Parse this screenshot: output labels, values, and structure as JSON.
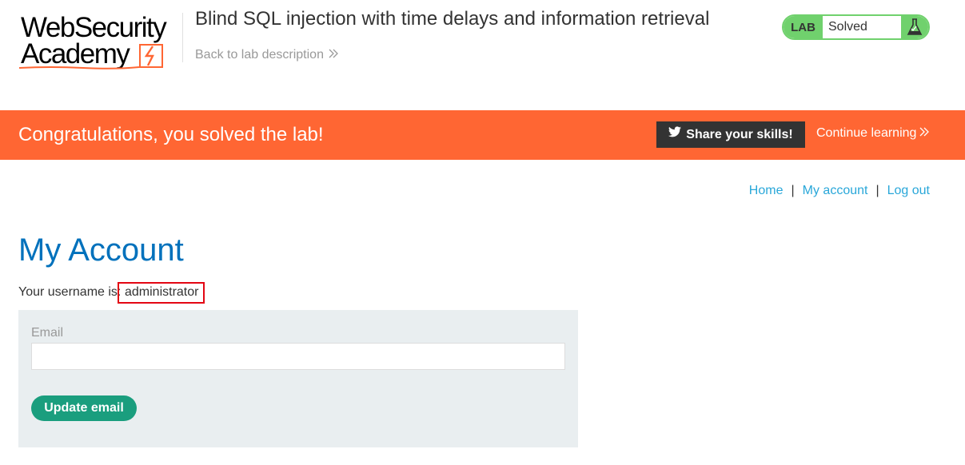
{
  "header": {
    "logo_line1": "WebSecurity",
    "logo_line2": "Academy",
    "lab_title": "Blind SQL injection with time delays and information retrieval",
    "back_link": "Back to lab description",
    "lab_badge": "LAB",
    "lab_status": "Solved"
  },
  "banner": {
    "message": "Congratulations, you solved the lab!",
    "share_button": "Share your skills!",
    "continue_link": "Continue learning"
  },
  "nav": {
    "items": [
      "Home",
      "My account",
      "Log out"
    ],
    "separator": "|"
  },
  "account": {
    "title": "My Account",
    "username_prefix": "Your username is:",
    "username": "administrator",
    "email_label": "Email",
    "email_value": "",
    "update_button": "Update email"
  },
  "colors": {
    "brand_orange": "#ff6633",
    "lab_green": "#70d16d",
    "link_blue": "#29a7d9",
    "title_blue": "#0071bc",
    "button_teal": "#1a9e7e",
    "highlight_red": "#e30613"
  },
  "icons": {
    "logo": "web-security-academy-logo",
    "back": "double-chevron-right-icon",
    "flask": "flask-icon",
    "share": "twitter-icon"
  }
}
